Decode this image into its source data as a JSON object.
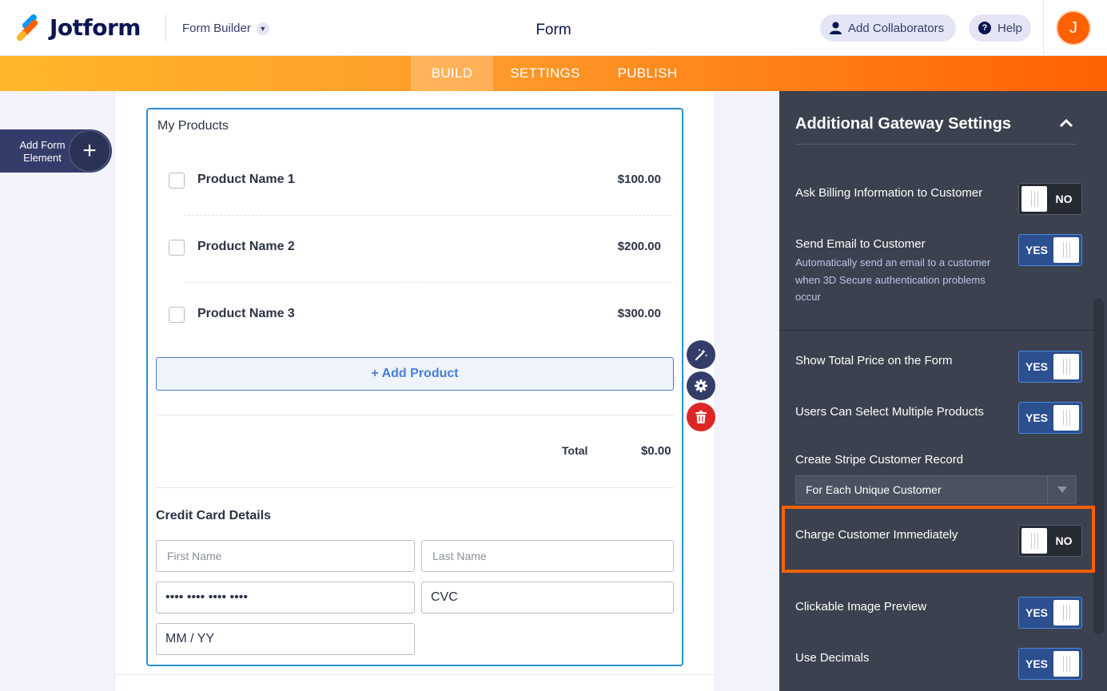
{
  "header": {
    "brand": "Jotform",
    "builder_label": "Form Builder",
    "title": "Form",
    "collaborators_label": "Add Collaborators",
    "help_label": "Help",
    "avatar_initial": "J"
  },
  "nav": {
    "tabs": [
      {
        "label": "BUILD",
        "active": true
      },
      {
        "label": "SETTINGS",
        "active": false
      },
      {
        "label": "PUBLISH",
        "active": false
      }
    ]
  },
  "left": {
    "add_element_label": "Add Form Element"
  },
  "form": {
    "field_title": "My Products",
    "products": [
      {
        "name": "Product Name 1",
        "price": "$100.00"
      },
      {
        "name": "Product Name 2",
        "price": "$200.00"
      },
      {
        "name": "Product Name 3",
        "price": "$300.00"
      }
    ],
    "add_product_label": "+ Add Product",
    "total_label": "Total",
    "total_value": "$0.00",
    "credit_card_title": "Credit Card Details",
    "first_name_placeholder": "First Name",
    "last_name_placeholder": "Last Name",
    "card_number_value": "•••• •••• •••• ••••",
    "cvc_value": "CVC",
    "expiry_value": "MM / YY"
  },
  "panel": {
    "title": "Additional Gateway Settings",
    "options": [
      {
        "label": "Ask Billing Information to Customer",
        "state": "NO"
      },
      {
        "label": "Send Email to Customer",
        "description": "Automatically send an email to a customer when 3D Secure authentication problems occur",
        "state": "YES"
      },
      {
        "label": "Show Total Price on the Form",
        "state": "YES"
      },
      {
        "label": "Users Can Select Multiple Products",
        "state": "YES"
      },
      {
        "label": "Charge Customer Immediately",
        "state": "NO"
      },
      {
        "label": "Clickable Image Preview",
        "state": "YES"
      },
      {
        "label": "Use Decimals",
        "state": "YES"
      }
    ],
    "stripe_record_label": "Create Stripe Customer Record",
    "stripe_record_value": "For Each Unique Customer"
  },
  "colors": {
    "brand_orange": "#ff6100",
    "brand_yellow": "#ffb629",
    "panel_bg": "#3b414e",
    "toggle_yes": "#2b4f8f",
    "highlight": "#ff6100",
    "field_border": "#2e8fcf"
  }
}
